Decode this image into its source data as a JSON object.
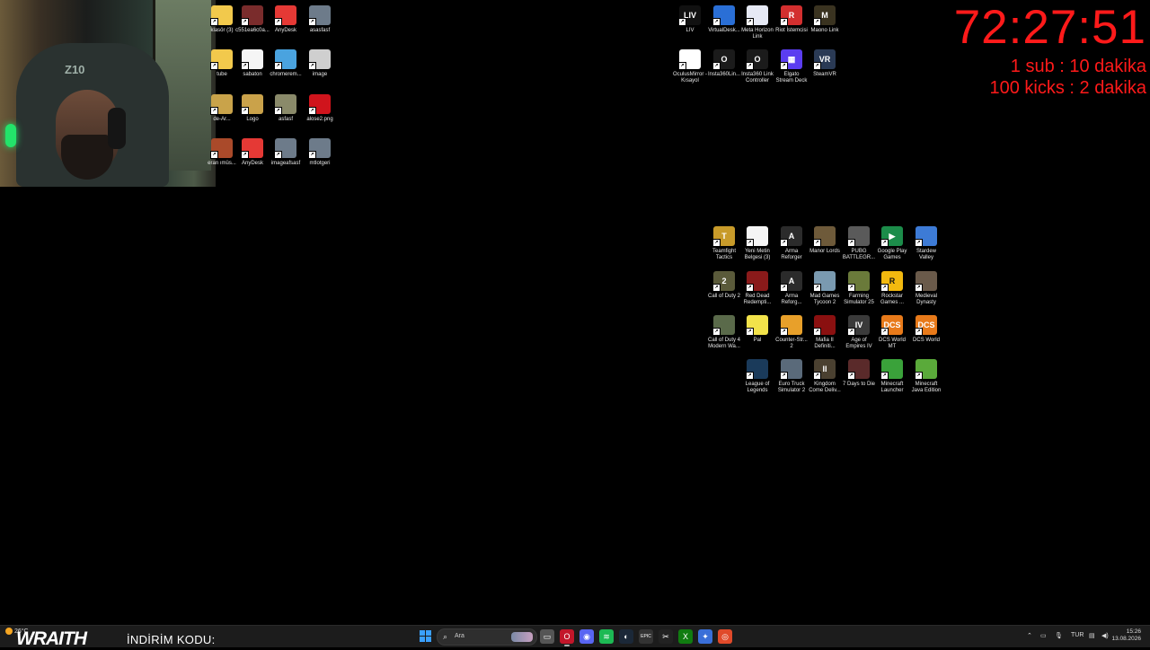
{
  "timer": {
    "time": "72:27:51",
    "rule_sub": "1 sub : 10 dakika",
    "rule_kicks": "100 kicks : 2 dakika"
  },
  "webcam": {
    "chair_logo": "Z10"
  },
  "desktop_left": [
    {
      "label": "klasör (3)",
      "icon": "folder-icon",
      "color": "#f2c94c"
    },
    {
      "label": "c551ea6c0a...",
      "icon": "image-thumbnail-icon",
      "color": "#7a2c2c"
    },
    {
      "label": "AnyDesk",
      "icon": "anydesk-icon",
      "color": "#e53935"
    },
    {
      "label": "asasfasf",
      "icon": "image-thumbnail-icon",
      "color": "#6d7b8a"
    },
    {
      "label": "tube",
      "icon": "folder-icon",
      "color": "#f2c94c"
    },
    {
      "label": "sabaton",
      "icon": "document-icon",
      "color": "#f5f5f5"
    },
    {
      "label": "chromerem...",
      "icon": "chrome-remote-icon",
      "color": "#4aa3df"
    },
    {
      "label": "image",
      "icon": "image-thumbnail-icon",
      "color": "#cfcfcf"
    },
    {
      "label": "de-Ar...",
      "icon": "image-thumbnail-icon",
      "color": "#c9a34a"
    },
    {
      "label": "Logo",
      "icon": "logo-image-icon",
      "color": "#caa24a"
    },
    {
      "label": "asfasf",
      "icon": "image-thumbnail-icon",
      "color": "#8a8a6a"
    },
    {
      "label": "alose2.png",
      "icon": "opera-icon",
      "color": "#d0141c"
    },
    {
      "label": "eran ımüs...",
      "icon": "image-thumbnail-icon",
      "color": "#aa4a2a"
    },
    {
      "label": "AnyDesk",
      "icon": "anydesk-icon",
      "color": "#e53935"
    },
    {
      "label": "imageafsasf",
      "icon": "image-thumbnail-icon",
      "color": "#6d7b8a"
    },
    {
      "label": "mtlotgeri",
      "icon": "image-thumbnail-icon",
      "color": "#6d7b8a"
    }
  ],
  "desktop_top_right": [
    {
      "label": "LIV",
      "icon": "liv-icon",
      "color": "#111111",
      "glyph": "LIV"
    },
    {
      "label": "VirtualDesk...",
      "icon": "virtual-desktop-icon",
      "color": "#2a6fd6",
      "glyph": ""
    },
    {
      "label": "Meta Horizon Link",
      "icon": "meta-horizon-icon",
      "color": "#e6e9f5",
      "glyph": ""
    },
    {
      "label": "Riot İstemcisi",
      "icon": "riot-client-icon",
      "color": "#d32f2f",
      "glyph": "R"
    },
    {
      "label": "Maono Link",
      "icon": "maono-link-icon",
      "color": "#3a3320",
      "glyph": "M"
    },
    {
      "label": "OculusMirror - Kısayol",
      "icon": "oculus-mirror-icon",
      "color": "#ffffff",
      "glyph": ""
    },
    {
      "label": "Insta360Lin...",
      "icon": "insta360-link-icon",
      "color": "#1b1b1b",
      "glyph": "O"
    },
    {
      "label": "Insta360 Link Controller",
      "icon": "insta360-controller-icon",
      "color": "#1b1b1b",
      "glyph": "O"
    },
    {
      "label": "Elgato Stream Deck",
      "icon": "stream-deck-icon",
      "color": "#5b3df0",
      "glyph": "▦"
    },
    {
      "label": "SteamVR",
      "icon": "steamvr-icon",
      "color": "#2a3a55",
      "glyph": "VR"
    }
  ],
  "desktop_games": [
    {
      "label": "Teamfight Tactics",
      "icon": "teamfight-tactics-icon",
      "color": "#c89b2a",
      "glyph": "T"
    },
    {
      "label": "Yeni Metin Belgesi (3)",
      "icon": "text-document-icon",
      "color": "#f5f5f5",
      "glyph": ""
    },
    {
      "label": "Arma Reforger",
      "icon": "arma-reforger-icon",
      "color": "#2b2b2b",
      "glyph": "A"
    },
    {
      "label": "Manor Lords",
      "icon": "manor-lords-icon",
      "color": "#6e5a3a",
      "glyph": ""
    },
    {
      "label": "PUBG BATTLEGR...",
      "icon": "pubg-icon",
      "color": "#5a5a5a",
      "glyph": ""
    },
    {
      "label": "Google Play Games",
      "icon": "google-play-games-icon",
      "color": "#1c8c4a",
      "glyph": "▶"
    },
    {
      "label": "Stardew Valley",
      "icon": "stardew-valley-icon",
      "color": "#3d7bd6",
      "glyph": ""
    },
    {
      "label": "Call of Duty 2",
      "icon": "call-of-duty-2-icon",
      "color": "#5a5a3a",
      "glyph": "2"
    },
    {
      "label": "Red Dead Redempti...",
      "icon": "red-dead-icon",
      "color": "#8a1a1a",
      "glyph": ""
    },
    {
      "label": "Arma Reforg...",
      "icon": "arma-reforger-icon",
      "color": "#2b2b2b",
      "glyph": "A"
    },
    {
      "label": "Mad Games Tycoon 2",
      "icon": "mad-games-tycoon-icon",
      "color": "#7a9ab0",
      "glyph": ""
    },
    {
      "label": "Farming Simulator 25",
      "icon": "farming-simulator-icon",
      "color": "#6a7a3a",
      "glyph": ""
    },
    {
      "label": "Rockstar Games ...",
      "icon": "rockstar-games-icon",
      "color": "#f2b90f",
      "glyph": "R"
    },
    {
      "label": "Medieval Dynasty",
      "icon": "medieval-dynasty-icon",
      "color": "#6a5a4a",
      "glyph": ""
    },
    {
      "label": "Call of Duty 4 Modern Wa...",
      "icon": "call-of-duty-4-icon",
      "color": "#5a6a4a",
      "glyph": ""
    },
    {
      "label": "Pal",
      "icon": "palworld-icon",
      "color": "#f2e24a",
      "glyph": ""
    },
    {
      "label": "Counter-Str... 2",
      "icon": "counter-strike-2-icon",
      "color": "#e8a02a",
      "glyph": ""
    },
    {
      "label": "Mafia II Definiti...",
      "icon": "mafia-2-icon",
      "color": "#8a1010",
      "glyph": ""
    },
    {
      "label": "Age of Empires IV",
      "icon": "age-of-empires-4-icon",
      "color": "#3a3a3a",
      "glyph": "IV"
    },
    {
      "label": "DCS World MT",
      "icon": "dcs-world-mt-icon",
      "color": "#e87a1a",
      "glyph": "DCS"
    },
    {
      "label": "DCS World",
      "icon": "dcs-world-icon",
      "color": "#e87a1a",
      "glyph": "DCS"
    },
    {
      "label": "League of Legends",
      "icon": "league-of-legends-icon",
      "color": "#1a3a5a",
      "glyph": ""
    },
    {
      "label": "Euro Truck Simulator 2",
      "icon": "euro-truck-simulator-icon",
      "color": "#5a6a7a",
      "glyph": ""
    },
    {
      "label": "Kingdom Come Deliv...",
      "icon": "kingdom-come-icon",
      "color": "#4a4030",
      "glyph": "II"
    },
    {
      "label": "7 Days to Die",
      "icon": "seven-days-to-die-icon",
      "color": "#5a2a2a",
      "glyph": ""
    },
    {
      "label": "Minecraft Launcher",
      "icon": "minecraft-launcher-icon",
      "color": "#3aa23a",
      "glyph": ""
    },
    {
      "label": "Minecraft Java Edition",
      "icon": "minecraft-java-icon",
      "color": "#5aaa3a",
      "glyph": ""
    }
  ],
  "taskbar": {
    "weather_temp": "26°C",
    "promo_brand": "WRAITH",
    "promo_text": "İNDİRİM KODU:",
    "search_placeholder": "Ara",
    "apps": [
      {
        "icon": "file-explorer-icon",
        "color": "#555555",
        "glyph": "▭"
      },
      {
        "icon": "opera-gx-icon",
        "color": "#c2162a",
        "glyph": "O"
      },
      {
        "icon": "discord-icon",
        "color": "#5865f2",
        "glyph": "◉"
      },
      {
        "icon": "spotify-icon",
        "color": "#1db954",
        "glyph": "≋"
      },
      {
        "icon": "steam-icon",
        "color": "#1b2838",
        "glyph": "◐"
      },
      {
        "icon": "epic-games-icon",
        "color": "#333333",
        "glyph": "EPIC"
      },
      {
        "icon": "capcut-icon",
        "color": "#222222",
        "glyph": "✂"
      },
      {
        "icon": "xbox-icon",
        "color": "#107c10",
        "glyph": "X"
      },
      {
        "icon": "copilot-icon",
        "color": "#3a6fd8",
        "glyph": "✦"
      },
      {
        "icon": "chrome-icon",
        "color": "#e04a2a",
        "glyph": "◎"
      }
    ],
    "tray_lang": "TUR",
    "clock_time": "15:26",
    "clock_date": "13.08.2026"
  }
}
